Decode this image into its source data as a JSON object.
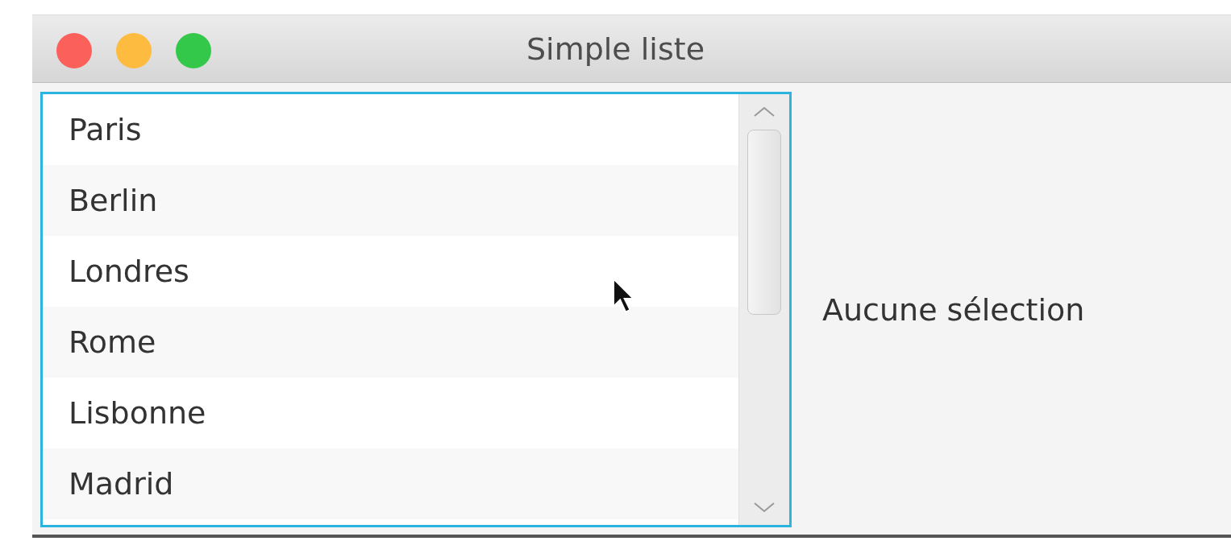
{
  "window": {
    "title": "Simple liste"
  },
  "list": {
    "items": [
      {
        "label": "Paris",
        "selected": false
      },
      {
        "label": "Berlin",
        "selected": false
      },
      {
        "label": "Londres",
        "selected": false
      },
      {
        "label": "Rome",
        "selected": false
      },
      {
        "label": "Lisbonne",
        "selected": false
      },
      {
        "label": "Madrid",
        "selected": false
      }
    ]
  },
  "selection_label": "Aucune sélection"
}
